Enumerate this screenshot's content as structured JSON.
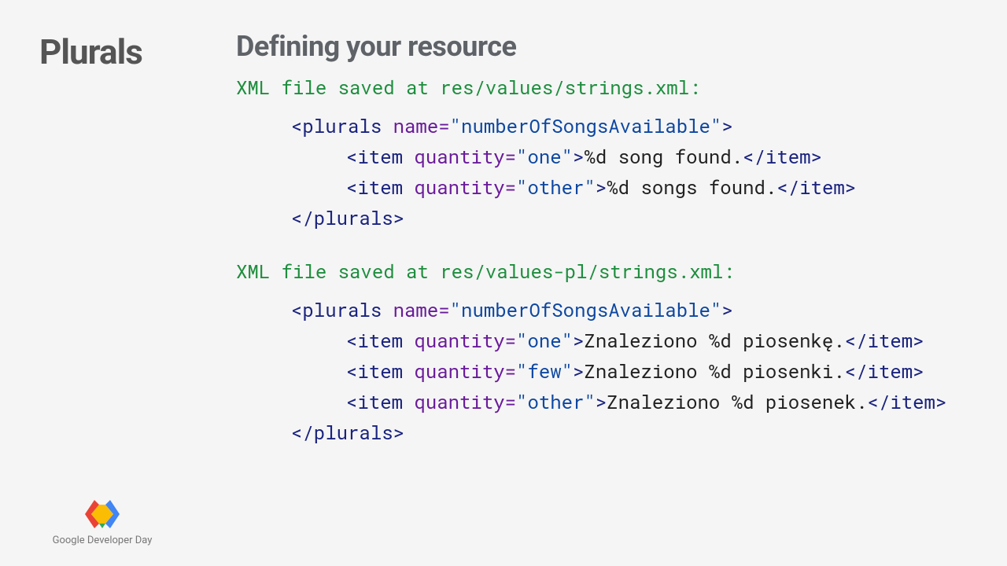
{
  "left": {
    "title": "Plurals"
  },
  "heading": "Defining your resource",
  "file1_path": "XML file saved at res/values/strings.xml:",
  "file2_path": "XML file saved at res/values-pl/strings.xml:",
  "plurals_name": "numberOfSongsAvailable",
  "file1": {
    "items": [
      {
        "quantity": "one",
        "text": "%d song found."
      },
      {
        "quantity": "other",
        "text": "%d songs found."
      }
    ]
  },
  "file2": {
    "items": [
      {
        "quantity": "one",
        "text": "Znaleziono %d piosenkę."
      },
      {
        "quantity": "few",
        "text": "Znaleziono %d piosenki."
      },
      {
        "quantity": "other",
        "text": "Znaleziono %d piosenek."
      }
    ]
  },
  "footer": {
    "brand": "Google Developer Day"
  }
}
